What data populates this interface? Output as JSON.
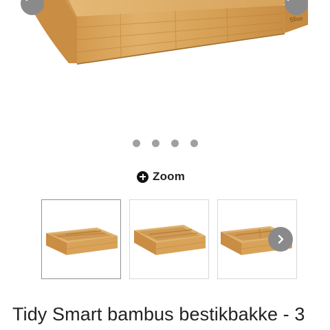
{
  "gallery": {
    "main_image": {
      "icon": "bamboo-tray-image",
      "brand_mark": "5five"
    },
    "prev_icon": "chevron-left-icon",
    "next_icon": "chevron-right-icon",
    "dot_count": 4
  },
  "zoom": {
    "icon": "plus-circle-icon",
    "label": "Zoom"
  },
  "thumbnails": [
    {
      "icon": "bamboo-tray-thumbnail",
      "active": true
    },
    {
      "icon": "bamboo-tray-thumbnail",
      "active": false
    },
    {
      "icon": "bamboo-tray-thumbnail",
      "active": false
    }
  ],
  "thumbnails_next_icon": "chevron-right-icon",
  "product": {
    "title": "Tidy Smart bambus bestikbakke - 3"
  },
  "colors": {
    "bamboo": "#d9a45a",
    "bamboo_dark": "#b97e36",
    "arrow_bg": "#8a8a8a",
    "dot": "#a0a0a0"
  }
}
